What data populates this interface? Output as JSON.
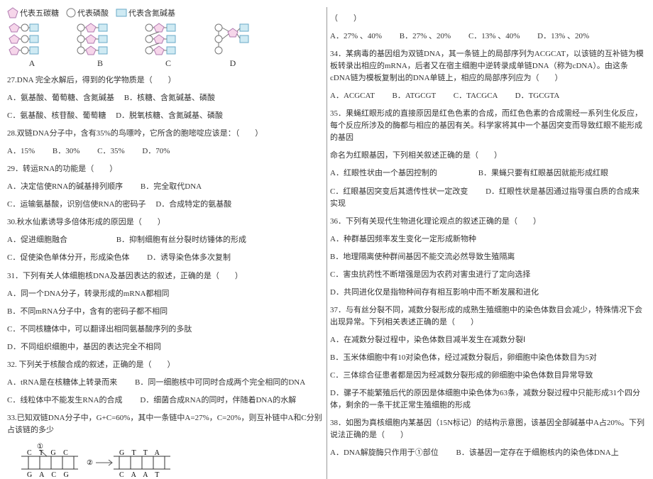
{
  "legend": {
    "pentose": "代表五碳糖",
    "phosphate": "代表磷酸",
    "base": "代表含氮碱基"
  },
  "dia_labels": {
    "A": "A",
    "B": "B",
    "C": "C",
    "D": "D"
  },
  "q27": {
    "stem": "27.DNA 完全水解后，得到的化学物质是（　　）",
    "optA": "A．氨基酸、葡萄糖、含氮碱基",
    "optB": "B．核糖、含氮碱基、磷酸",
    "optC": "C．氨基酸、核苷酸、葡萄糖",
    "optD": "D．脱氧核糖、含氮碱基、磷酸"
  },
  "q28": {
    "stem": "28.双链DNA分子中，含有35%的鸟嘌呤，它所含的胞嘧啶应该是：（　　）",
    "optA": "A．15%",
    "optB": "B．30%",
    "optC": "C．35%",
    "optD": "D．70%"
  },
  "q29": {
    "stem": "29．转运RNA的功能是（　　）",
    "optA": "A．决定信使RNA的碱基排列顺序",
    "optB": "B．完全取代DNA",
    "optC": "C．运输氨基酸，识别信使RNA的密码子",
    "optD": "D．合成特定的氨基酸"
  },
  "q30": {
    "stem": "30.秋水仙素诱导多倍体形成的原因是（　　）",
    "optA": "A．促进细胞融合",
    "optB": "B．抑制细胞有丝分裂时纺锤体的形成",
    "optC": "C．促使染色单体分开，形成染色体",
    "optD": "D．诱导染色体多次复制"
  },
  "q31": {
    "stem": "31．下列有关人体细胞核DNA及基因表达的叙述，正确的是（　　）",
    "optA": "A．同一个DNA分子，转录形成的mRNA都相同",
    "optB": "B．不同mRNA分子中，含有的密码子都不相同",
    "optC": "C．不同核糖体中，可以翻译出相同氨基酸序列的多肽",
    "optD": "D．不同组织细胞中，基因的表达完全不相同"
  },
  "q32": {
    "stem": "32. 下列关于核酸合成的叙述，正确的是（　　）",
    "optA": "A．tRNA是在核糖体上转录而来",
    "optB": "B．同一细胞核中可同时合成两个完全相同的DNA",
    "optC": "C．线粒体中不能发生RNA的合成",
    "optD": "D．细菌合成RNA的同时，伴随着DNA的水解"
  },
  "q33": {
    "stem": "33.已知双链DNA分子中，G+C=60%，其中一条链中A=27%，C=20%，则互补链中A和C分别占该链的多少",
    "blank": "（　　）",
    "optA": "A．27% 、40%",
    "optB": "B．27% 、20%",
    "optC": "C．13% 、40%",
    "optD": "D．13% 、20%"
  },
  "q33_fig": {
    "mark1": "①",
    "mark2": "②",
    "top1": "C T G C",
    "top2": "G T T A",
    "bot1": "G A C G",
    "bot2": "C A A T"
  },
  "q34": {
    "stem": "34．某病毒的基因组为双链DNA，其一条链上的局部序列为ACGCAT，以该链的互补链为模板转录出相应的mRNA，后者又在宿主细胞中逆转录成单链DNA（称为cDNA）。由这条cDNA链为模板复制出的DNA单链上，相应的局部序列应为（　　）",
    "optA": "A．ACGCAT",
    "optB": "B．ATGCGT",
    "optC": "C．TACGCA",
    "optD": "D．TGCGTA"
  },
  "q35": {
    "stem": "35．果蝇红眼形成的直接原因是红色色素的合成，而红色色素的合成需经一系列生化反应，每个反应所涉及的酶都与相应的基因有关。科学家将其中一个基因突变而导致红眼不能形成的基因",
    "cont1": "命名为红眼基因，下列相关叙述正确的是（　　）",
    "optA": "A．红眼性状由一个基因控制的",
    "optB": "B．果蝇只要有红眼基因就能形成红眼",
    "optC": "C．红眼基因突变后其遗传性状一定改变",
    "optD": "D．红眼性状是基因通过指导蛋白质的合成来实现"
  },
  "q36": {
    "stem": "36．下列有关现代生物进化理论观点的叙述正确的是（　　）",
    "optA": "A．种群基因频率发生变化一定形成新物种",
    "optB": "B．地理隔离使种群间基因不能交流必然导致生殖隔离",
    "optC": "C．害虫抗药性不断增强是因为农药对害虫进行了定向选择",
    "optD": "D．共同进化仅是指物种间存有相互影响中而不断发展和进化"
  },
  "q37": {
    "stem": "37．与有丝分裂不同，减数分裂形成的成熟生殖细胞中的染色体数目会减少，特殊情况下会出现异常。下列相关表述正确的是（　　）",
    "optA": "A．在减数分裂过程中，染色体数目减半发生在减数分裂Ⅰ",
    "optB": "B．玉米体细胞中有10对染色体，经过减数分裂后，卵细胞中染色体数目为5对",
    "optC": "C．三体综合征患者都是因为经减数分裂形成的卵细胞中染色体数目异常导致",
    "optD": "D．骡子不能繁殖后代的原因是体细胞中染色体为63条，减数分裂过程中只能形成31个四分体，剩余的一条干扰正常生殖细胞的形成"
  },
  "q38": {
    "stem": "38．如图为真核细胞内某基因（15N标记）的结构示意图，该基因全部碱基中A占20%。下列说法正确的是（　　）",
    "optA": "A．DNA解旋酶只作用于①部位",
    "optB": "B．该基因一定存在于细胞核内的染色体DNA上"
  }
}
